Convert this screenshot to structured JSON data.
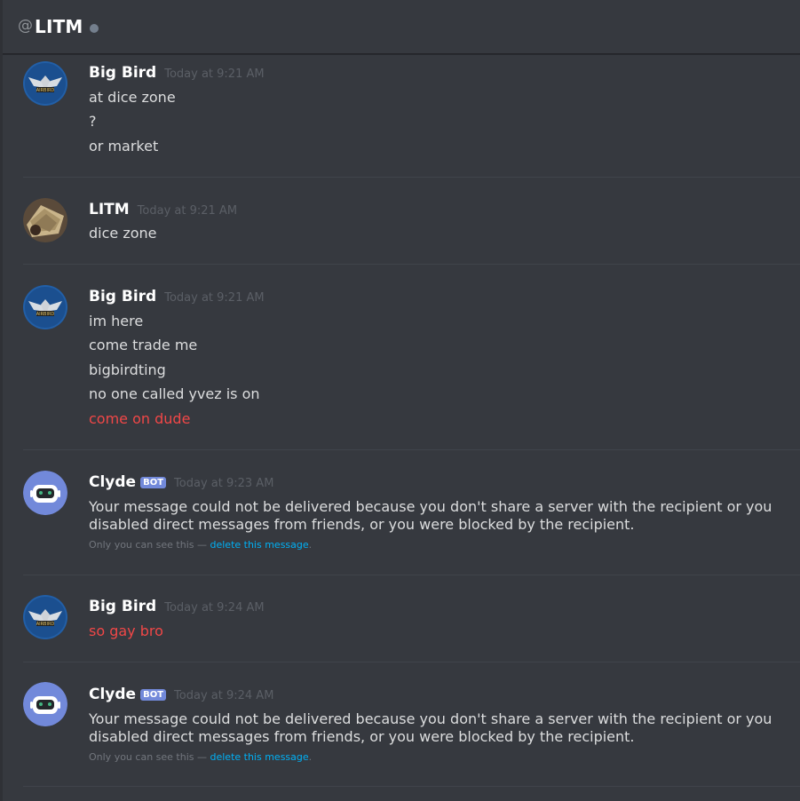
{
  "header": {
    "at_symbol": "@",
    "channel_name": "LITM",
    "status": "offline"
  },
  "messages": [
    {
      "author": "Big Bird",
      "time": "Today at 9:21 AM",
      "lines": [
        "at dice zone",
        "?",
        "or market"
      ]
    },
    {
      "author": "LITM",
      "time": "Today at 9:21 AM",
      "lines": [
        "dice zone"
      ]
    },
    {
      "author": "Big Bird",
      "time": "Today at 9:21 AM",
      "lines": [
        "im here",
        "come trade me",
        "bigbirdting",
        "no one called yvez is on",
        "come on dude"
      ]
    },
    {
      "author": "Clyde",
      "bot_tag": "BOT",
      "time": "Today at 9:23 AM",
      "text": "Your message could not be delivered because you don't share a server with the recipient or you disabled direct messages from friends, or you were blocked by the recipient.",
      "note_prefix": "Only you can see this — ",
      "note_link": "delete this message",
      "note_suffix": "."
    },
    {
      "author": "Big Bird",
      "time": "Today at 9:24 AM",
      "lines": [
        "so gay bro"
      ]
    },
    {
      "author": "Clyde",
      "bot_tag": "BOT",
      "time": "Today at 9:24 AM",
      "text": "Your message could not be delivered because you don't share a server with the recipient or you disabled direct messages from friends, or you were blocked by the recipient.",
      "note_prefix": "Only you can see this — ",
      "note_link": "delete this message",
      "note_suffix": "."
    }
  ],
  "colors": {
    "background": "#36393f",
    "author": "#ffffff",
    "timestamp": "#5b5f66",
    "alert_text": "#f04747",
    "link": "#00b0f4",
    "bot_tag": "#7289da"
  }
}
